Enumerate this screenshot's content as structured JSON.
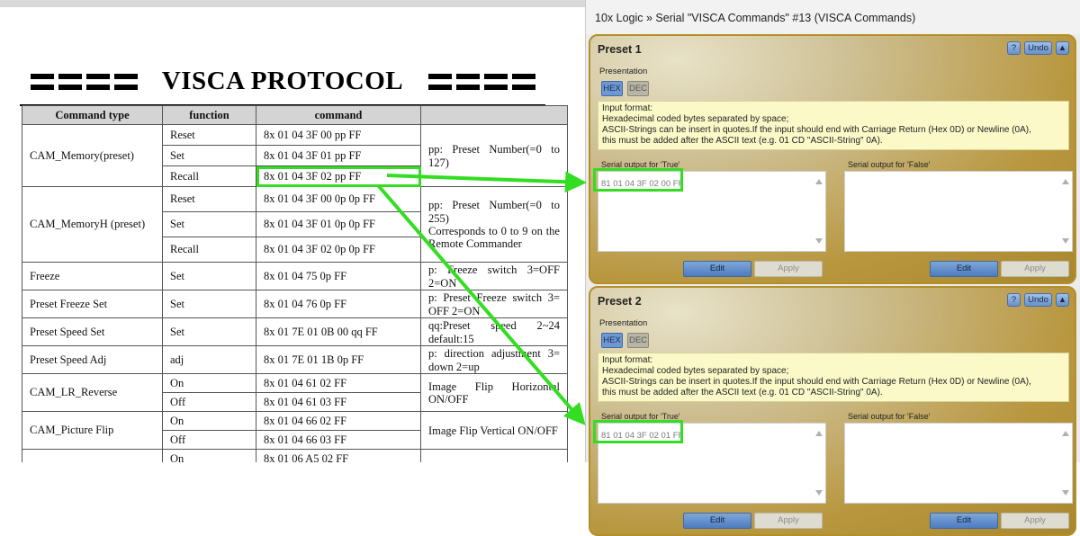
{
  "document": {
    "title": "VISCA PROTOCOL",
    "table": {
      "headers": [
        "Command type",
        "function",
        "command",
        ""
      ],
      "rows": {
        "mem_type": "CAM_Memory(preset)",
        "mem_reset": "Reset",
        "mem_reset_cmd": "8x 01 04 3F 00 pp FF",
        "mem_set": "Set",
        "mem_set_cmd": "8x 01 04 3F 01 pp FF",
        "mem_recall": "Recall",
        "mem_recall_cmd": "8x 01 04 3F 02 pp FF",
        "mem_note": "pp: Preset Number(=0 to 127)",
        "memh_type": "CAM_MemoryH (preset)",
        "memh_reset": "Reset",
        "memh_reset_cmd": "8x 01 04 3F 00 0p 0p FF",
        "memh_set": "Set",
        "memh_set_cmd": "8x 01 04 3F 01 0p 0p FF",
        "memh_recall": "Recall",
        "memh_recall_cmd": "8x 01 04 3F 02 0p 0p FF",
        "memh_note_1": "pp: Preset Number(=0 to 255)",
        "memh_note_2": "Corresponds to 0 to 9 on the Remote Commander",
        "freeze_type": "Freeze",
        "freeze_fn": "Set",
        "freeze_cmd": "8x 01 04 75 0p FF",
        "freeze_note": "p: Freeze switch 3=OFF 2=ON",
        "pfreeze_type": "Preset Freeze Set",
        "pfreeze_fn": "Set",
        "pfreeze_cmd": "8x 01 04 76 0p FF",
        "pfreeze_note": "p: Preset Freeze switch 3= OFF 2=ON",
        "pspeed_type": "Preset Speed Set",
        "pspeed_fn": "Set",
        "pspeed_cmd": "8x 01 7E 01 0B 00 qq FF",
        "pspeed_note": "qq:Preset speed 2~24 default:15",
        "padj_type": "Preset Speed Adj",
        "padj_fn": "adj",
        "padj_cmd": "8x 01 7E 01 1B 0p FF",
        "padj_note": "p: direction adjustment 3= down 2=up",
        "lr_type": "CAM_LR_Reverse",
        "lr_on": "On",
        "lr_on_cmd": "8x 01 04 61 02 FF",
        "lr_off": "Off",
        "lr_off_cmd": "8x 01 04 61 03 FF",
        "lr_note": "Image Flip Horizontal ON/OFF",
        "pf_type": "CAM_Picture Flip",
        "pf_on": "On",
        "pf_on_cmd": "8x 01 04 66 02 FF",
        "pf_off": "Off",
        "pf_off_cmd": "8x 01 04 66 03 FF",
        "pf_note": "Image Flip Vertical ON/OFF",
        "last_fn": "On",
        "last_cmd": "8x 01 06 A5 02 FF"
      }
    }
  },
  "window": {
    "title": "10x Logic » Serial \"VISCA Commands\" #13 (VISCA Commands)",
    "help_label": "?",
    "undo_label": "Undo",
    "collapse_label": "▲",
    "presentation_label": "Presentation",
    "hex_label": "HEX",
    "dec_label": "DEC",
    "info_line_1": "Input format:",
    "info_line_2": "Hexadecimal coded bytes separated by space;",
    "info_line_3": "ASCII-Strings can be insert in quotes.If the input should end with Carriage Return (Hex 0D) or Newline (0A),",
    "info_line_4": "this must be added after the ASCII text (e.g. 01 CD \"ASCII-String\" 0A).",
    "true_label": "Serial output for 'True'",
    "false_label": "Serial output for 'False'",
    "edit_label": "Edit",
    "apply_label": "Apply",
    "presets": [
      {
        "title": "Preset 1",
        "true_value": "81 01 04 3F 02 00 FF",
        "false_value": ""
      },
      {
        "title": "Preset 2",
        "true_value": "81 01 04 3F 02 01 FF",
        "false_value": ""
      }
    ]
  },
  "colors": {
    "highlight": "#33dd22",
    "panel_gold": "#b8973f",
    "button_blue": "#6e98d2"
  }
}
